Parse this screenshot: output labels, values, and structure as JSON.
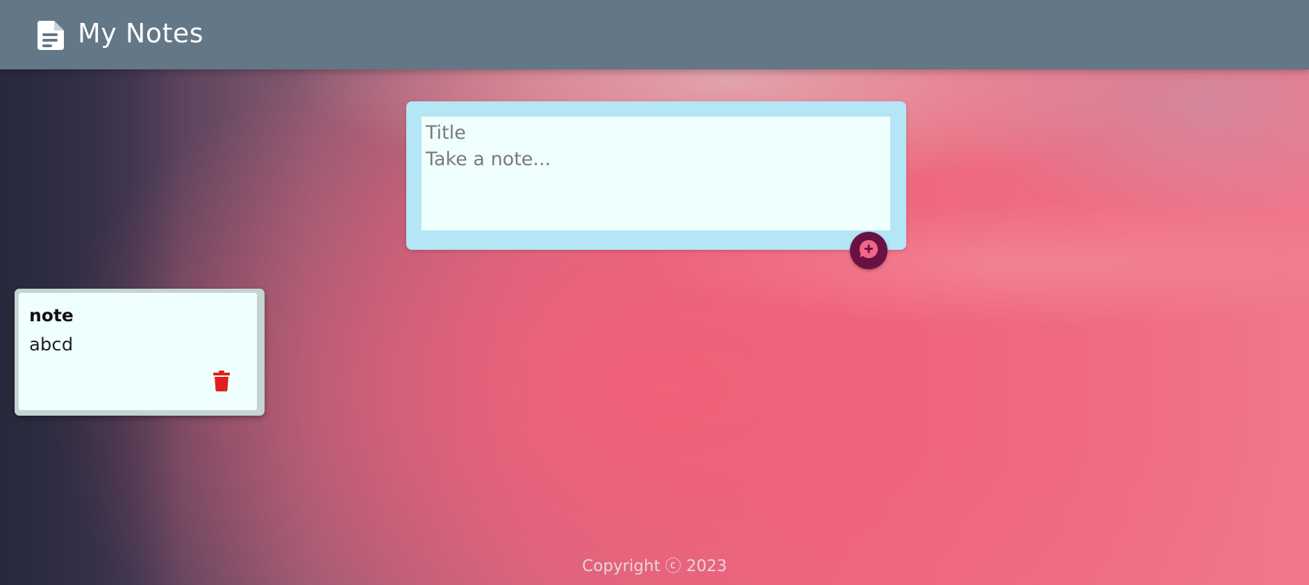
{
  "header": {
    "title": "My Notes",
    "icon": "note-document-icon",
    "background_color": "#637786"
  },
  "composer": {
    "title_placeholder": "Title",
    "content_placeholder": "Take a note...",
    "title_value": "",
    "content_value": "",
    "add_button_icon": "add-comment-icon",
    "background_color": "#b4e6f5",
    "add_button_color": "#6a1143"
  },
  "notes": [
    {
      "title": "note",
      "content": "abcd",
      "delete_icon": "trash-icon",
      "delete_color": "#e0201a"
    }
  ],
  "footer": {
    "copyright": "Copyright ⓒ 2023"
  }
}
